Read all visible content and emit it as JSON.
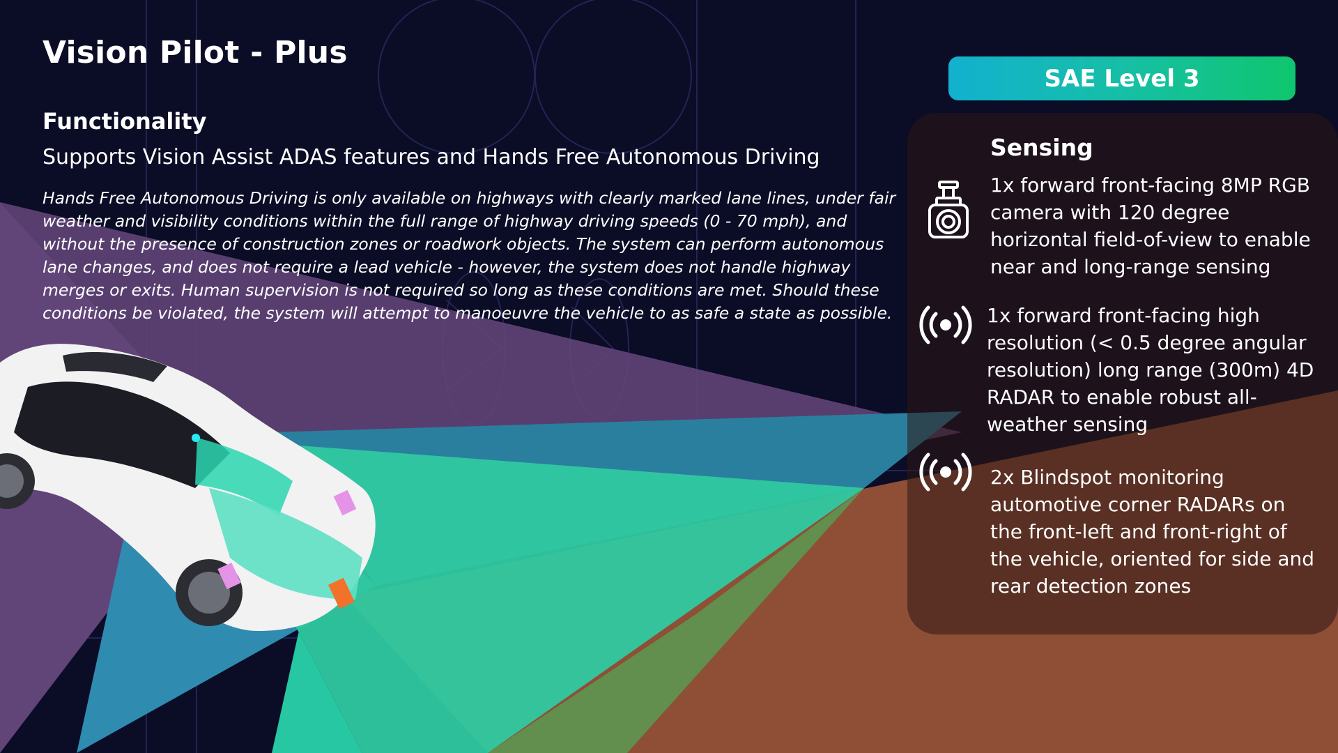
{
  "header": {
    "title": "Vision Pilot - Plus"
  },
  "functionality": {
    "heading": "Functionality",
    "subtitle": "Supports Vision Assist ADAS features and Hands Free Autonomous Driving",
    "description": "Hands Free Autonomous Driving is only available on highways with clearly marked lane lines, under fair weather and visibility conditions within the full range of highway driving speeds (0 - 70 mph), and without the presence of construction zones or roadwork objects. The system can perform autonomous lane changes, and does not require a lead vehicle - however, the system does not handle highway merges or exits. Human supervision is not required so long as these conditions are met. Should these conditions be violated, the system will attempt to manoeuvre the vehicle to as safe a state as possible."
  },
  "badge": {
    "label": "SAE Level 3",
    "gradient_start": "#12b1cf",
    "gradient_end": "#0fc66e"
  },
  "sensing": {
    "heading": "Sensing",
    "items": [
      {
        "icon": "camera-icon",
        "text": "1x forward front-facing 8MP RGB camera with 120 degree horizontal field-of-view to enable near and long-range sensing"
      },
      {
        "icon": "radar-icon",
        "text": "1x forward front-facing high resolution (< 0.5 degree angular resolution) long range (300m) 4D RADAR to enable robust all-weather sensing"
      },
      {
        "icon": "radar-icon",
        "text": "2x Blindspot monitoring automotive corner RADARs on the front-left and front-right of the vehicle, oriented for side and rear detection zones"
      }
    ]
  },
  "colors": {
    "background": "#0b0c26",
    "left_radar_zone": "#614478",
    "right_radar_zone": "#8e4f36",
    "front_radar_cone": "#2a7f9e",
    "camera_cone": "#2fc9a0",
    "car_body": "#f2f2f2",
    "camera_marker": "#28e8f5",
    "corner_radar_marker": "#e593e6",
    "front_radar_marker": "#f2712b"
  }
}
